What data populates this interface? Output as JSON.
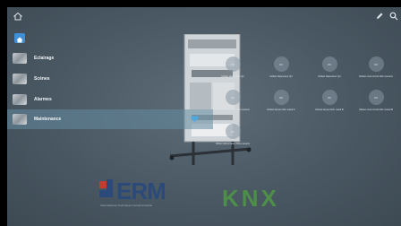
{
  "topbar": {
    "home_icon": "home-icon",
    "edit_icon": "pencil-icon",
    "search_icon": "search-icon"
  },
  "menu": [
    {
      "label": "Eclairage",
      "active": false
    },
    {
      "label": "Scènes",
      "active": false
    },
    {
      "label": "Alarmes",
      "active": false
    },
    {
      "label": "Maintenance",
      "active": true
    }
  ],
  "tiles": [
    {
      "value": "I/O",
      "label": "Défaut disjoncteur Q2"
    },
    {
      "value": "I/O",
      "label": "Défaut disjoncteur Q3"
    },
    {
      "value": "I/O",
      "label": "Défaut disjoncteur Q4"
    },
    {
      "value": "I/O",
      "label": "Défaut court-circuit DALI canal A"
    },
    {
      "value": "I/O",
      "label": "Défaut court-circuit DALI canal A"
    },
    {
      "value": "I/O",
      "label": "Défaut lampe DALI canal A"
    },
    {
      "value": "I/O",
      "label": "Défaut lampe DALI canal B"
    },
    {
      "value": "I/O",
      "label": "Défaut court-circuit DALI canal B"
    },
    {
      "value": "I/O",
      "label": "Défaut alimentation DALI canal A"
    }
  ],
  "logos": {
    "erm": "ERM",
    "erm_sub": "Automatismes Techniques Conseil Industrie",
    "knx": "KNX"
  },
  "colors": {
    "accent": "#3e8fd8",
    "erm": "#2c4a79",
    "knx": "#4d8e49"
  }
}
